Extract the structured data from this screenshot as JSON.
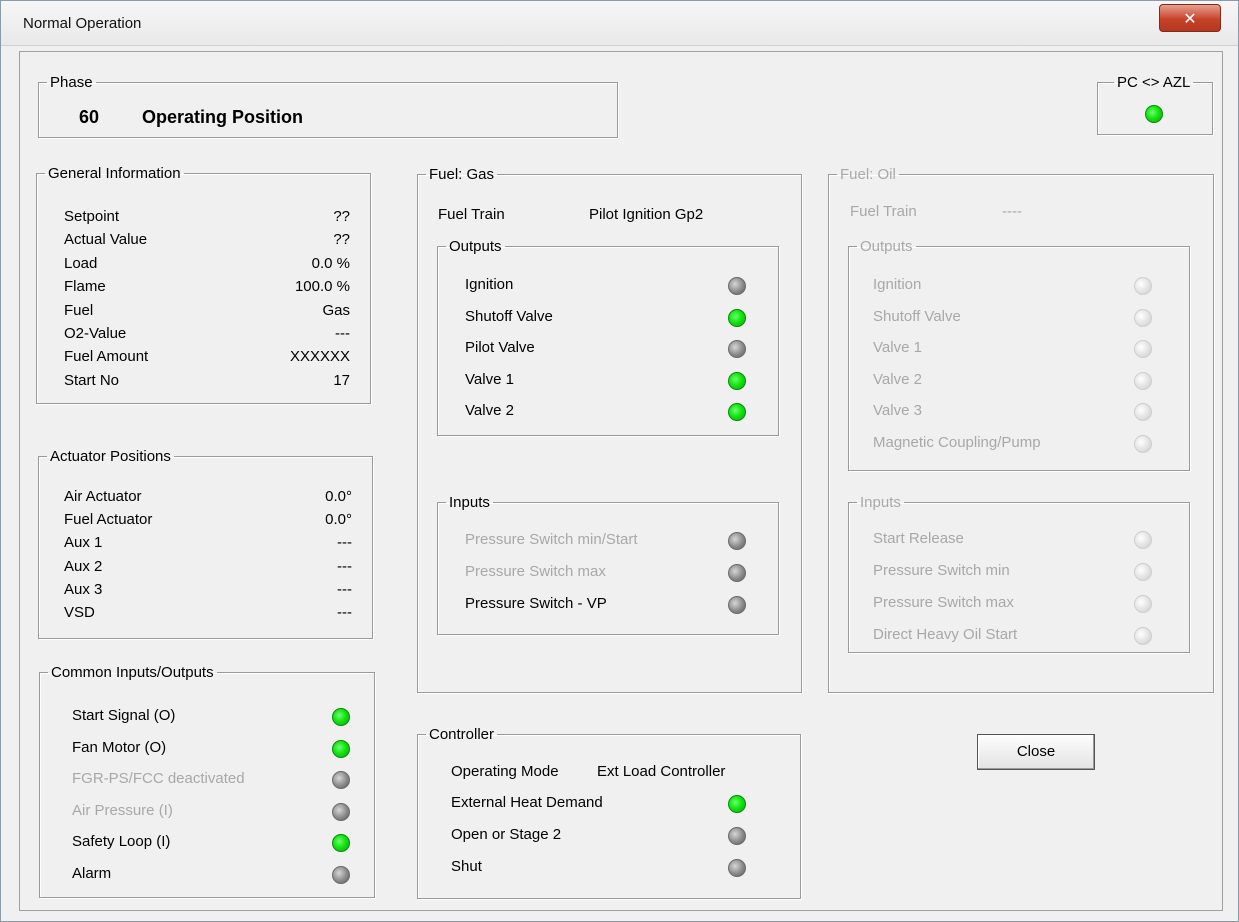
{
  "window": {
    "title": "Normal Operation",
    "close_glyph": "✕"
  },
  "phase": {
    "legend": "Phase",
    "number": "60",
    "text": "Operating Position"
  },
  "pc_azl": {
    "legend": "PC <> AZL",
    "status": "on"
  },
  "general_information": {
    "legend": "General Information",
    "rows": [
      {
        "label": "Setpoint",
        "value": "??"
      },
      {
        "label": "Actual Value",
        "value": "??"
      },
      {
        "label": "Load",
        "value": "0.0 %"
      },
      {
        "label": "Flame",
        "value": "100.0 %"
      },
      {
        "label": "Fuel",
        "value": "Gas"
      },
      {
        "label": "O2-Value",
        "value": "---"
      },
      {
        "label": "Fuel Amount",
        "value": "XXXXXX"
      },
      {
        "label": "Start No",
        "value": "17"
      }
    ]
  },
  "actuator_positions": {
    "legend": "Actuator Positions",
    "rows": [
      {
        "label": "Air Actuator",
        "value": "0.0°"
      },
      {
        "label": "Fuel Actuator",
        "value": "0.0°"
      },
      {
        "label": "Aux 1",
        "value": "---"
      },
      {
        "label": "Aux 2",
        "value": "---"
      },
      {
        "label": "Aux 3",
        "value": "---"
      },
      {
        "label": "VSD",
        "value": "---"
      }
    ]
  },
  "common_io": {
    "legend": "Common Inputs/Outputs",
    "rows": [
      {
        "label": "Start Signal (O)",
        "status": "on",
        "enabled": true
      },
      {
        "label": "Fan Motor (O)",
        "status": "on",
        "enabled": true
      },
      {
        "label": "FGR-PS/FCC deactivated",
        "status": "off",
        "enabled": false
      },
      {
        "label": "Air Pressure (I)",
        "status": "off",
        "enabled": false
      },
      {
        "label": "Safety Loop (I)",
        "status": "on",
        "enabled": true
      },
      {
        "label": "Alarm",
        "status": "off",
        "enabled": true
      }
    ]
  },
  "fuel_gas": {
    "legend": "Fuel: Gas",
    "fuel_train_label": "Fuel Train",
    "fuel_train_value": "Pilot Ignition Gp2",
    "outputs": {
      "legend": "Outputs",
      "rows": [
        {
          "label": "Ignition",
          "status": "off"
        },
        {
          "label": "Shutoff Valve",
          "status": "on"
        },
        {
          "label": "Pilot Valve",
          "status": "off"
        },
        {
          "label": "Valve 1",
          "status": "on"
        },
        {
          "label": "Valve 2",
          "status": "on"
        }
      ]
    },
    "inputs": {
      "legend": "Inputs",
      "rows": [
        {
          "label": "Pressure Switch min/Start",
          "status": "off",
          "enabled": false
        },
        {
          "label": "Pressure Switch max",
          "status": "off",
          "enabled": false
        },
        {
          "label": "Pressure Switch - VP",
          "status": "off",
          "enabled": true
        }
      ]
    }
  },
  "fuel_oil": {
    "legend": "Fuel: Oil",
    "fuel_train_label": "Fuel Train",
    "fuel_train_value": "----",
    "outputs": {
      "legend": "Outputs",
      "rows": [
        {
          "label": "Ignition"
        },
        {
          "label": "Shutoff Valve"
        },
        {
          "label": "Valve 1"
        },
        {
          "label": "Valve 2"
        },
        {
          "label": "Valve 3"
        },
        {
          "label": "Magnetic Coupling/Pump"
        }
      ]
    },
    "inputs": {
      "legend": "Inputs",
      "rows": [
        {
          "label": "Start Release"
        },
        {
          "label": "Pressure Switch min"
        },
        {
          "label": "Pressure Switch max"
        },
        {
          "label": "Direct Heavy Oil Start"
        }
      ]
    }
  },
  "controller": {
    "legend": "Controller",
    "operating_mode_label": "Operating Mode",
    "operating_mode_value": "Ext Load Controller",
    "rows": [
      {
        "label": "External Heat Demand",
        "status": "on"
      },
      {
        "label": "Open or Stage 2",
        "status": "off"
      },
      {
        "label": "Shut",
        "status": "off"
      }
    ]
  },
  "buttons": {
    "close": "Close"
  },
  "colors": {
    "led_on": "#14e414",
    "led_off": "#8a8a8a",
    "disabled_text": "#a8a8a8",
    "close_button": "#c6432a"
  }
}
